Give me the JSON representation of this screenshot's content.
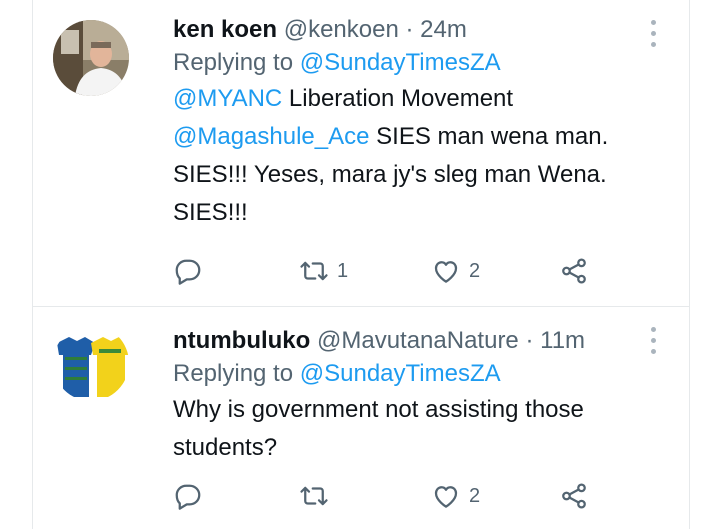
{
  "tweets": [
    {
      "name": "ken koen",
      "handle": "@kenkoen",
      "separator": "·",
      "time": "24m",
      "replying_prefix": "Replying to",
      "replying_to": "@SundayTimesZA",
      "body": [
        [
          {
            "t": "@MYANC",
            "m": true
          },
          {
            "t": " Liberation Movement",
            "m": false
          }
        ],
        [
          {
            "t": "@Magashule_Ace",
            "m": true
          },
          {
            "t": " SIES man wena man.",
            "m": false
          }
        ],
        [
          {
            "t": "SIES!!! Yeses, mara jy's sleg man Wena.",
            "m": false
          }
        ],
        [
          {
            "t": "SIES!!!",
            "m": false
          }
        ]
      ],
      "retweets": "1",
      "likes": "2"
    },
    {
      "name": "ntumbuluko",
      "handle": "@MavutanaNature",
      "separator": "·",
      "time": "11m",
      "replying_prefix": "Replying to",
      "replying_to": "@SundayTimesZA",
      "body": [
        [
          {
            "t": "Why is government not assisting those",
            "m": false
          }
        ],
        [
          {
            "t": "students?",
            "m": false
          }
        ]
      ],
      "retweets": "",
      "likes": "2"
    }
  ],
  "icons": {
    "reply": "reply-icon",
    "retweet": "retweet-icon",
    "like": "heart-icon",
    "share": "share-icon",
    "more": "more-icon"
  },
  "colors": {
    "text": "#0f1419",
    "secondary": "#536471",
    "link": "#1d9bf0",
    "border": "#e6e9eb"
  }
}
